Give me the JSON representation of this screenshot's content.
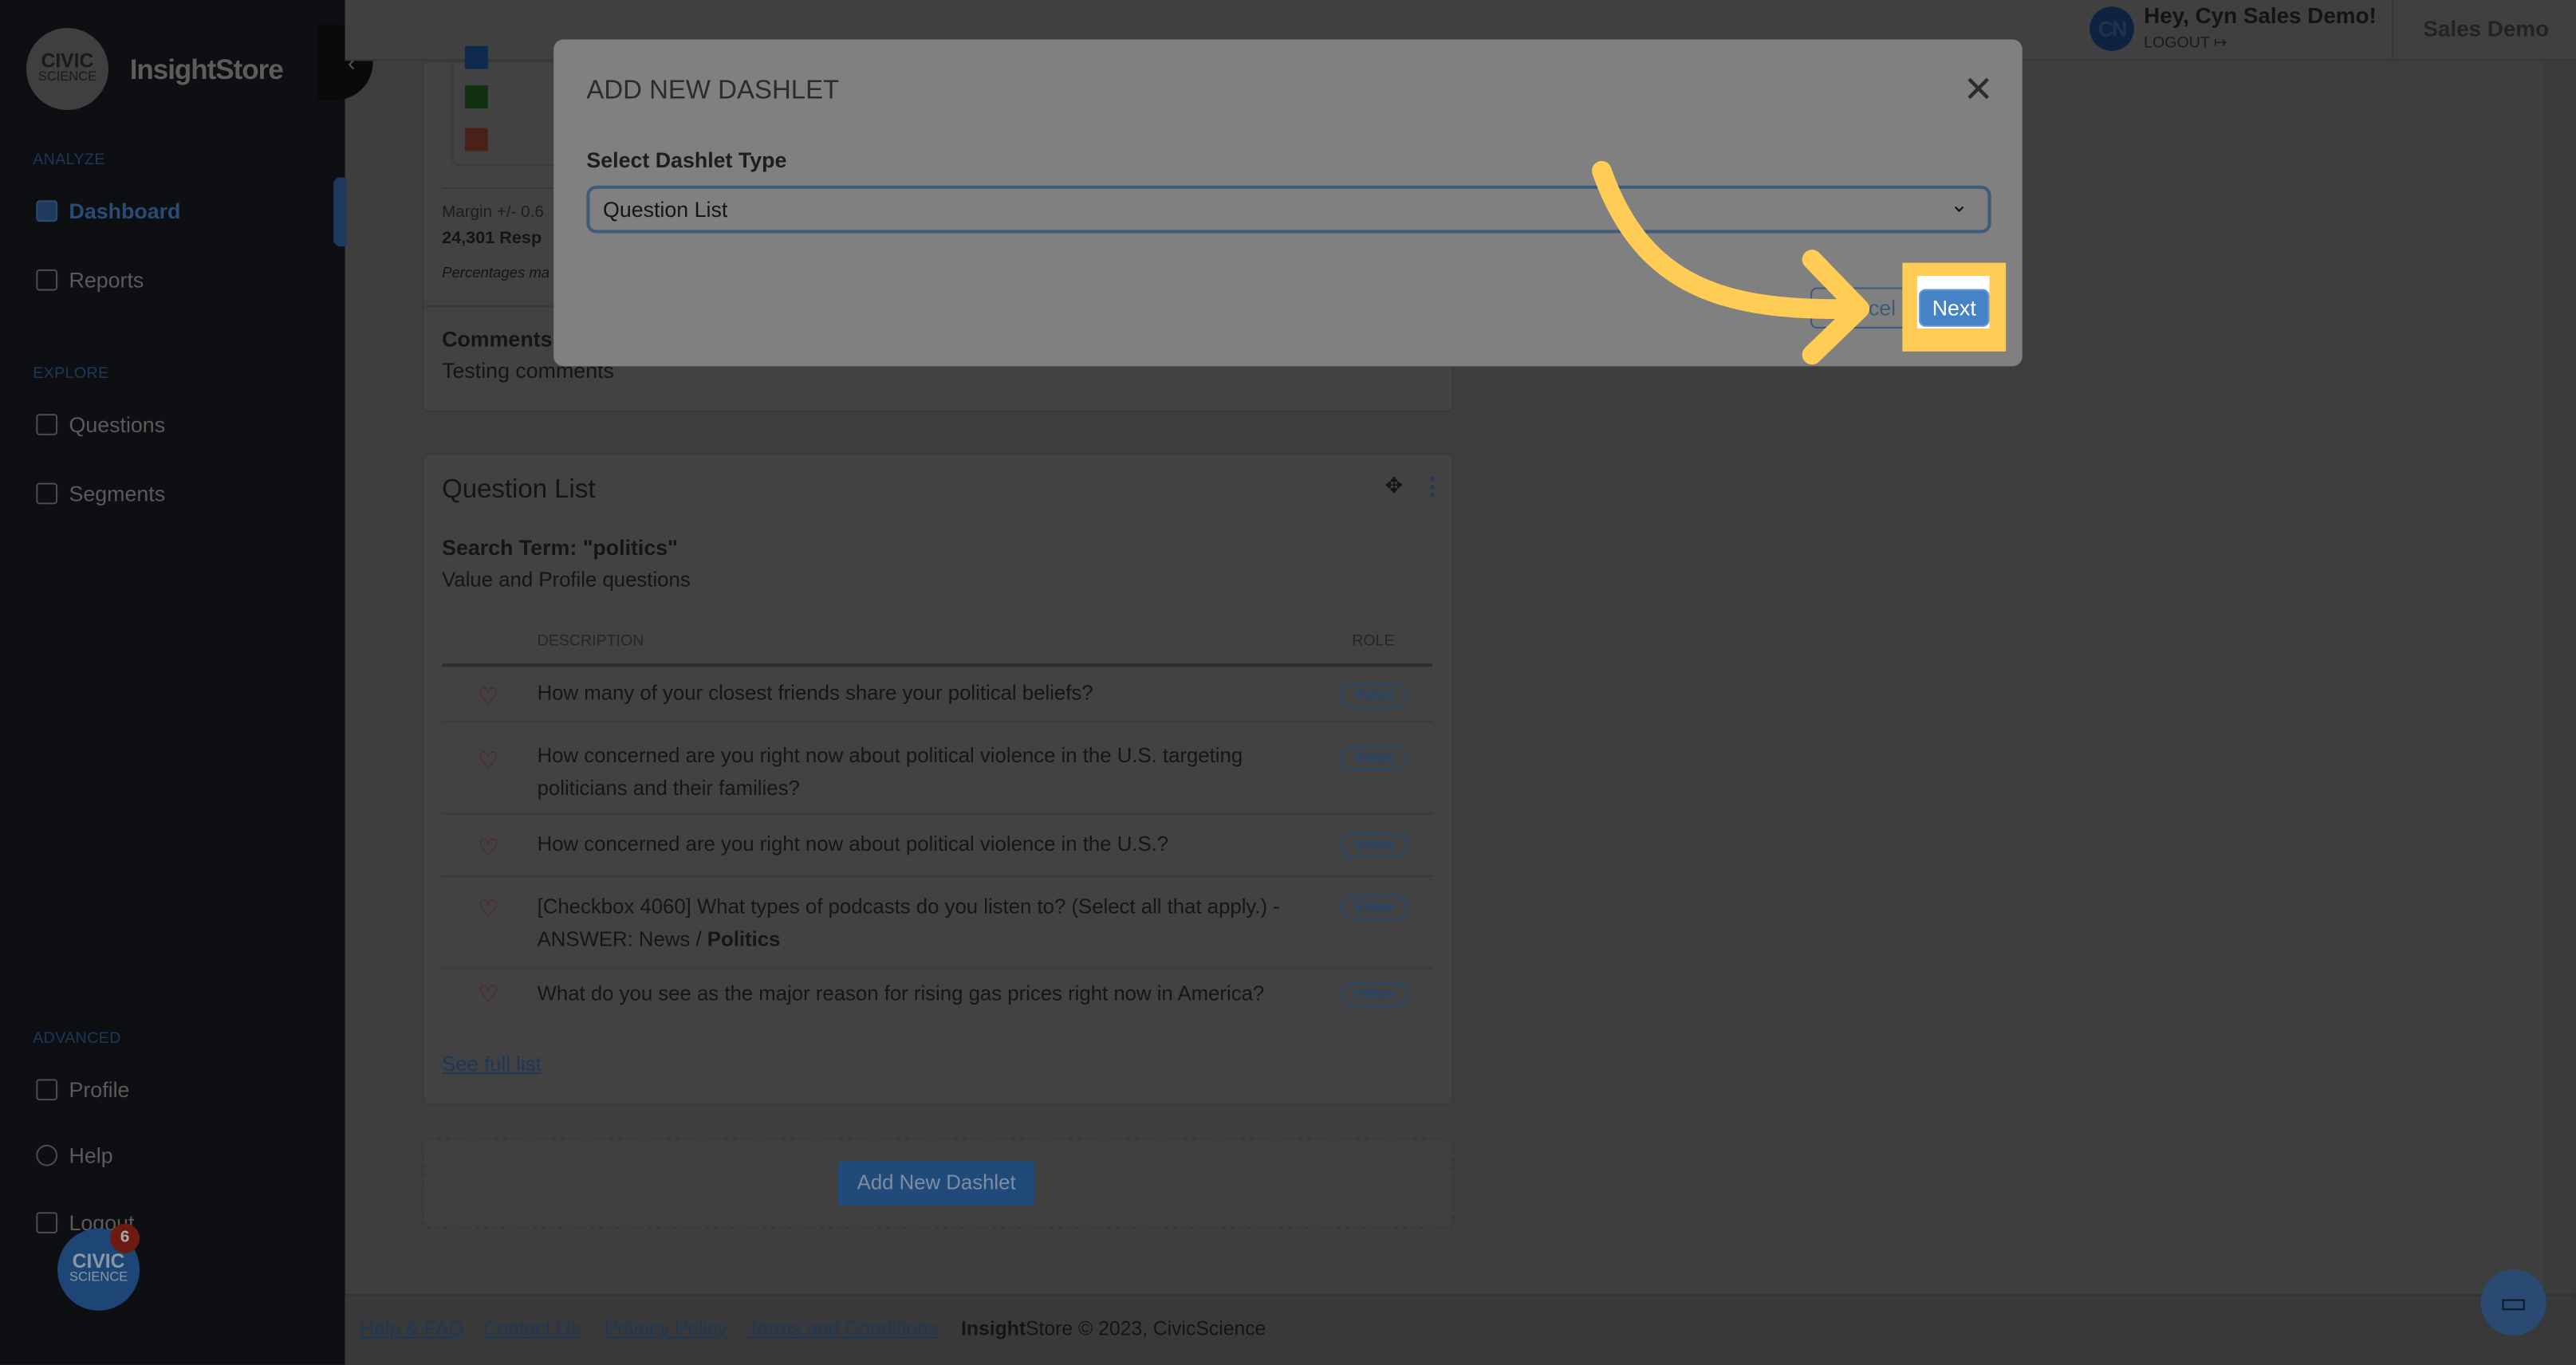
{
  "sidebar": {
    "logo_text": [
      "CIVIC",
      "SCIENCE"
    ],
    "brand": "InsightStore",
    "sections": [
      {
        "label": "ANALYZE",
        "items": [
          {
            "label": "Dashboard",
            "icon": "dashboard-icon",
            "active": true
          },
          {
            "label": "Reports",
            "icon": "report-icon"
          }
        ]
      },
      {
        "label": "EXPLORE",
        "items": [
          {
            "label": "Questions",
            "icon": "question-icon"
          },
          {
            "label": "Segments",
            "icon": "segments-icon"
          }
        ]
      },
      {
        "label": "ADVANCED",
        "items": [
          {
            "label": "Profile",
            "icon": "id-card-icon"
          },
          {
            "label": "Help",
            "icon": "lifebuoy-icon"
          },
          {
            "label": "Logout",
            "icon": "logout-icon"
          }
        ]
      }
    ],
    "notification_count": "6"
  },
  "header": {
    "avatar_initials": "CN",
    "greeting": "Hey, Cyn Sales Demo!",
    "logout": "LOGOUT",
    "org": "Sales Demo"
  },
  "top_card": {
    "legend_colors": [
      "#0f2a4c",
      "#10300f",
      "#4a2118"
    ],
    "margin": "Margin +/- 0.6",
    "responses": "24,301 Resp",
    "note": "Percentages ma",
    "comments_label": "Comments",
    "comments_text": "Testing comments"
  },
  "question_list": {
    "title": "Question List",
    "search_term": "Search Term: \"politics\"",
    "subtitle": "Value and Profile questions",
    "columns": [
      "DESCRIPTION",
      "ROLE"
    ],
    "rows": [
      {
        "text": "How many of your closest friends share your political beliefs?",
        "role": "Value"
      },
      {
        "text": "How concerned are you right now about political violence in the U.S. targeting politicians and their families?",
        "role": "Value"
      },
      {
        "text": "How concerned are you right now about political violence in the U.S.?",
        "role": "Value"
      },
      {
        "text": "[Checkbox 4060] What types of podcasts do you listen to? (Select all that apply.) - ANSWER: News / ",
        "bold": "Politics",
        "role": "Value"
      },
      {
        "text": "What do you see as the major reason for rising gas prices right now in America?",
        "role": "Value"
      }
    ],
    "see_full": "See full list"
  },
  "add_dashlet_button": "Add New Dashlet",
  "footer": {
    "links": [
      "Help & FAQ",
      "Contact Us",
      "Privacy Policy",
      "Terms and Conditions"
    ],
    "brand_bold": "Insight",
    "copyright": "Store © 2023, CivicScience"
  },
  "modal": {
    "title": "ADD NEW DASHLET",
    "label": "Select Dashlet Type",
    "selected": "Question List",
    "cancel": "Cancel",
    "next": "Next",
    "highlight_color": "#ffcd55"
  }
}
